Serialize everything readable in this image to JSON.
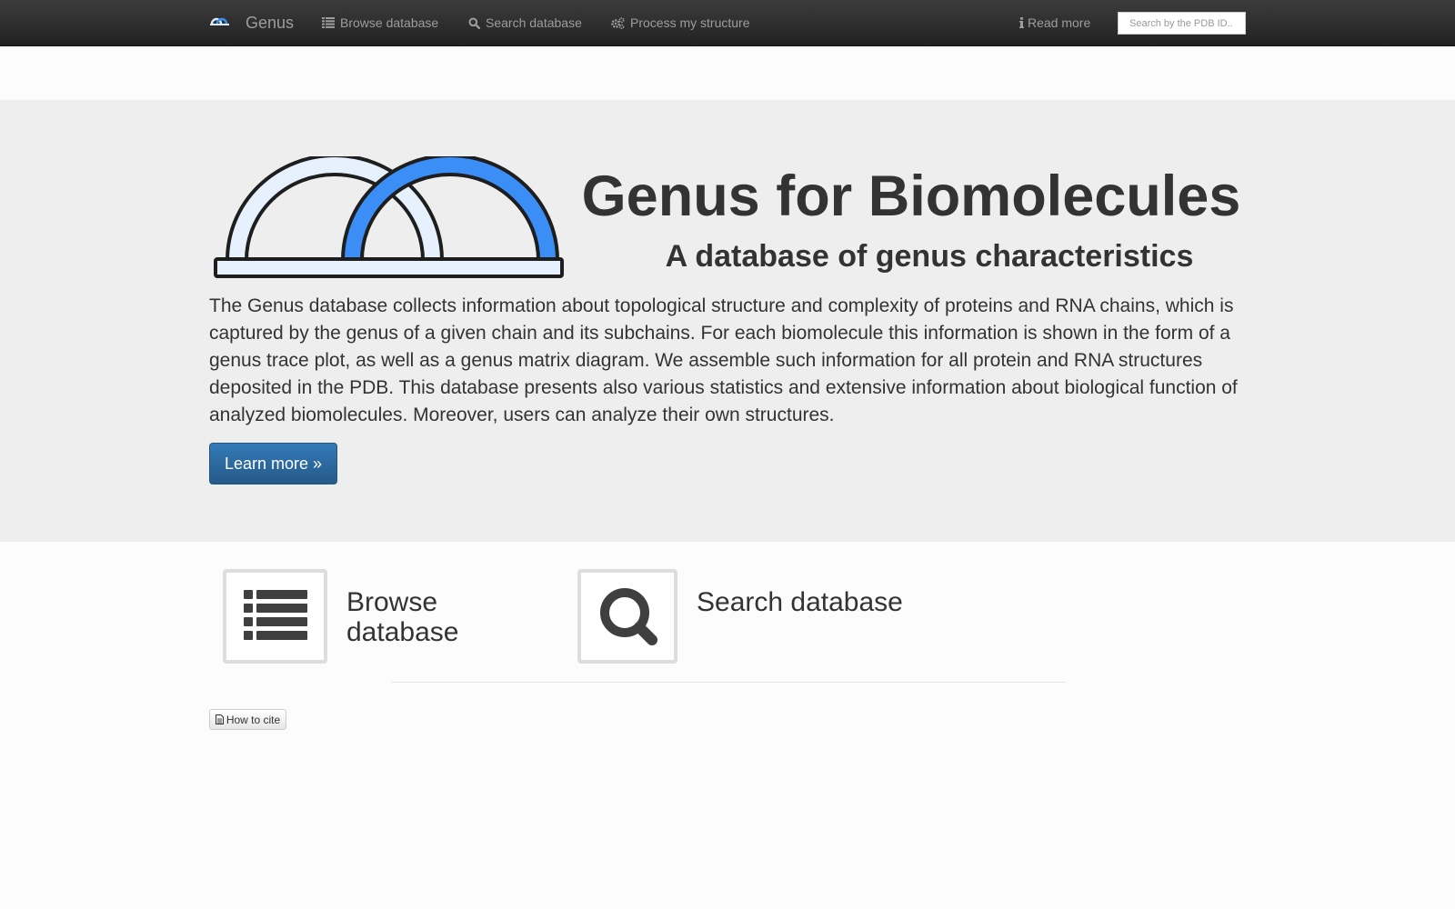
{
  "navbar": {
    "brand": "Genus",
    "links": [
      {
        "label": "Browse database",
        "icon": "list-icon"
      },
      {
        "label": "Search database",
        "icon": "search-icon"
      },
      {
        "label": "Process my structure",
        "icon": "cogs-icon"
      },
      {
        "label": "Read more",
        "icon": "info-icon"
      }
    ],
    "search_placeholder": "Search by the PDB ID.."
  },
  "hero": {
    "title": "Genus for Biomolecules",
    "subtitle": "A database of genus characteristics",
    "description": "The Genus database collects information about topological structure and complexity of proteins and RNA chains, which is captured by the genus of a given chain and its subchains. For each biomolecule this information is shown in the form of a genus trace plot, as well as a genus matrix diagram. We assemble such information for all protein and RNA structures deposited in the PDB. This database presents also various statistics and extensive information about biological function of analyzed biomolecules. Moreover, users can analyze their own structures.",
    "button": "Learn more »"
  },
  "features": {
    "browse": "Browse database",
    "search": "Search database"
  },
  "cite_button": "How to cite",
  "colors": {
    "navbar": "#222222",
    "jumbotron": "#eeeeee",
    "primary": "#337ab7",
    "logo_blue": "#3a8ef6",
    "logo_light": "#e6f1fd"
  }
}
